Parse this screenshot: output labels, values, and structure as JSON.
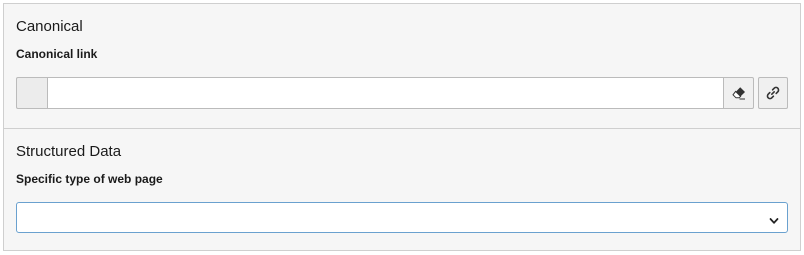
{
  "canonical": {
    "title": "Canonical",
    "label": "Canonical link",
    "input_value": "",
    "input_placeholder": "",
    "clear_icon": "eraser-icon",
    "link_icon": "link-icon"
  },
  "structured_data": {
    "title": "Structured Data",
    "label": "Specific type of web page",
    "selected_value": "",
    "chevron_icon": "chevron-down-icon"
  },
  "colors": {
    "panel_background": "#f6f6f6",
    "border": "#cfcfcf",
    "select_focus_border": "#6aa1cf"
  }
}
